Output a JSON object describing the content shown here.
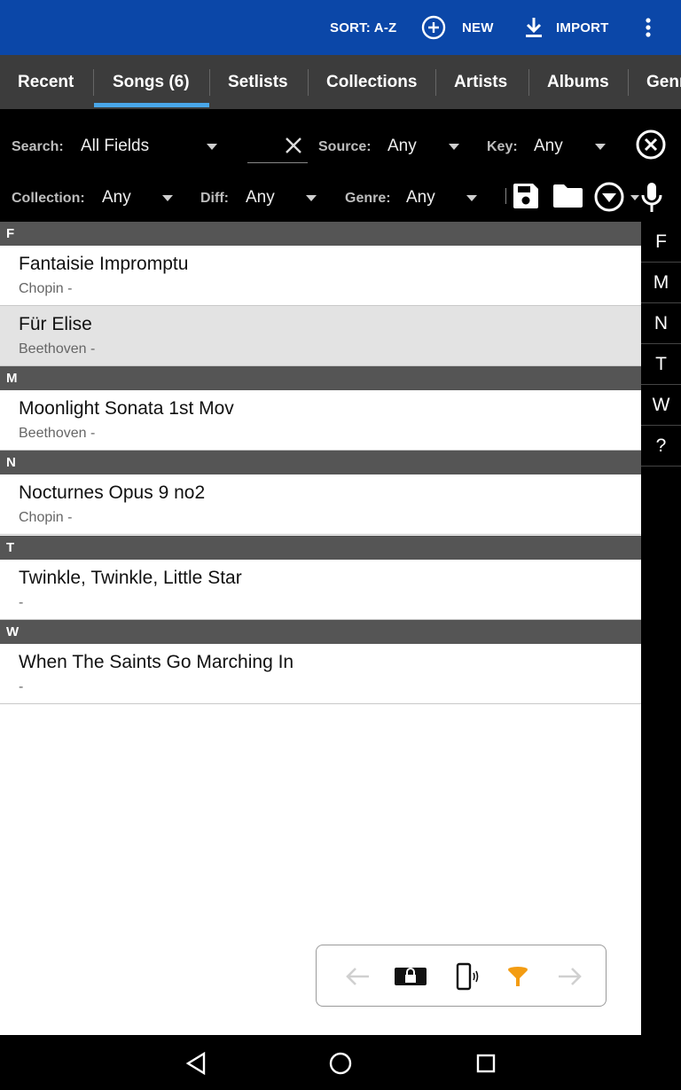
{
  "topbar": {
    "sort_label": "SORT: A-Z",
    "new_label": "NEW",
    "import_label": "IMPORT"
  },
  "tabs": [
    {
      "label": "Recent"
    },
    {
      "label": "Songs (6)",
      "active": true
    },
    {
      "label": "Setlists"
    },
    {
      "label": "Collections"
    },
    {
      "label": "Artists"
    },
    {
      "label": "Albums"
    },
    {
      "label": "Genres"
    }
  ],
  "filters": {
    "search_label": "Search:",
    "search_field": "All Fields",
    "search_text": "",
    "source_label": "Source:",
    "source_value": "Any",
    "key_label": "Key:",
    "key_value": "Any",
    "collection_label": "Collection:",
    "collection_value": "Any",
    "diff_label": "Diff:",
    "diff_value": "Any",
    "genre_label": "Genre:",
    "genre_value": "Any"
  },
  "sections": [
    {
      "letter": "F",
      "songs": [
        {
          "title": "Fantaisie Impromptu",
          "subtitle": "Chopin -"
        },
        {
          "title": "Für Elise",
          "subtitle": "Beethoven -",
          "selected": true
        }
      ]
    },
    {
      "letter": "M",
      "songs": [
        {
          "title": "Moonlight Sonata 1st Mov",
          "subtitle": "Beethoven -"
        }
      ]
    },
    {
      "letter": "N",
      "songs": [
        {
          "title": "Nocturnes Opus 9 no2",
          "subtitle": "Chopin -"
        }
      ]
    },
    {
      "letter": "T",
      "songs": [
        {
          "title": "Twinkle, Twinkle, Little Star",
          "subtitle": " -"
        }
      ]
    },
    {
      "letter": "W",
      "songs": [
        {
          "title": "When The Saints Go Marching In",
          "subtitle": " -"
        }
      ]
    }
  ],
  "index_letters": [
    "F",
    "M",
    "N",
    "T",
    "W",
    "?"
  ],
  "colors": {
    "appbar": "#0b47a8",
    "tab_indicator": "#49a6e9",
    "filter_accent": "#f39c12"
  }
}
